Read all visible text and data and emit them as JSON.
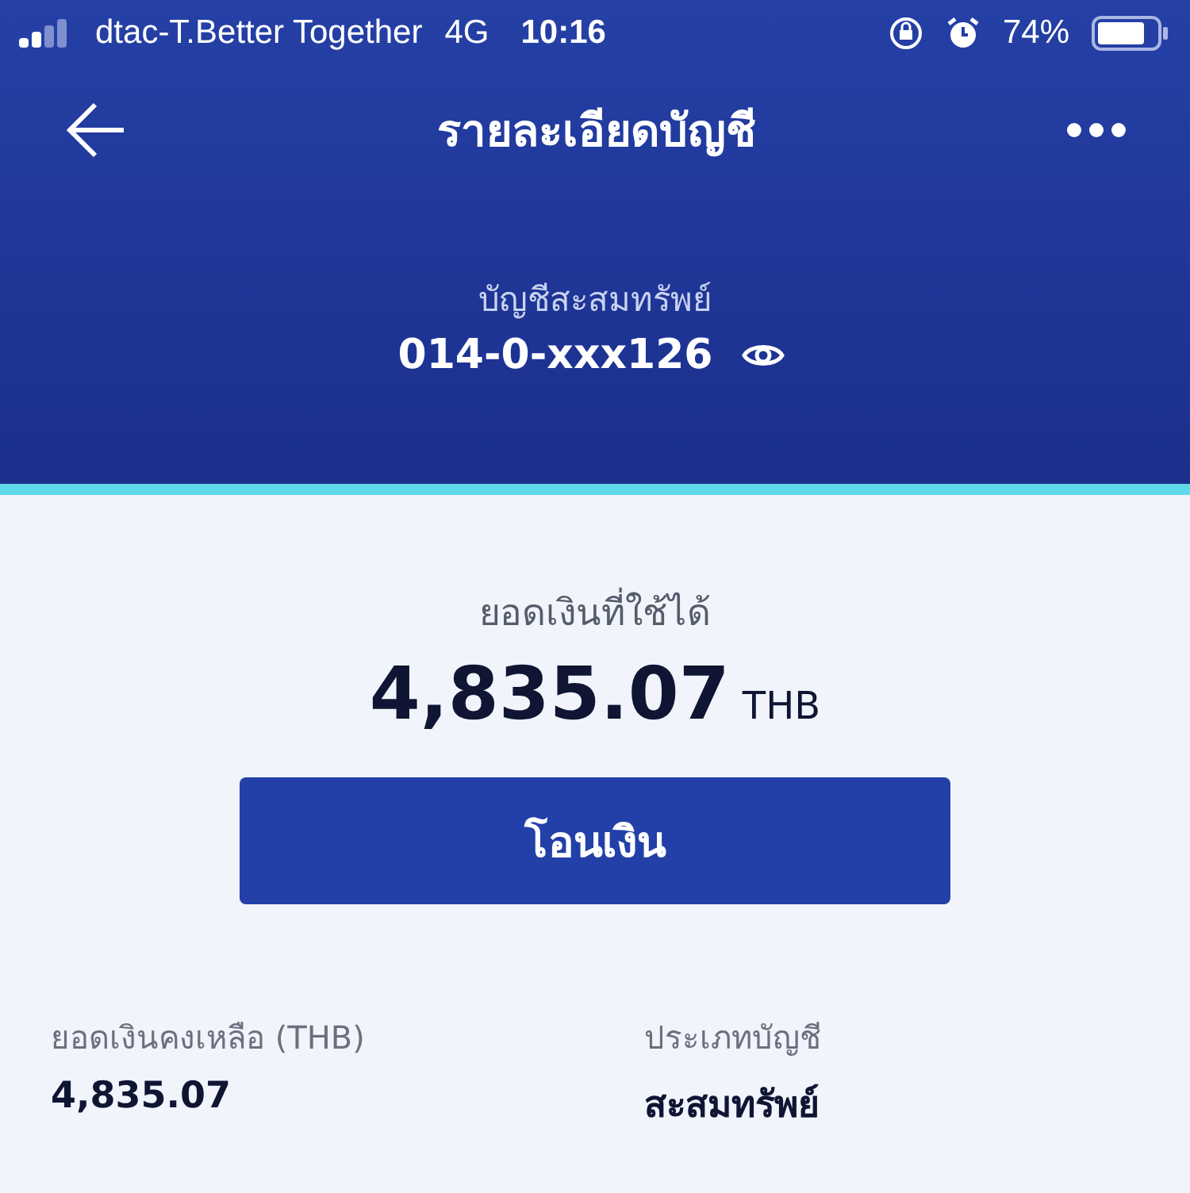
{
  "status_bar": {
    "carrier": "dtac-T.Better Together",
    "network": "4G",
    "time": "10:16",
    "battery": "74%"
  },
  "header": {
    "title": "รายละเอียดบัญชี",
    "account_type": "บัญชีสะสมทรัพย์",
    "account_number": "014-0-xxx126"
  },
  "balance": {
    "label": "ยอดเงินที่ใช้ได้",
    "amount": "4,835.07",
    "currency": "THB"
  },
  "action_button": "โอนเงิน",
  "details": [
    {
      "label": "ยอดเงินคงเหลือ (THB)",
      "value": "4,835.07"
    },
    {
      "label": "ประเภทบัญชี",
      "value": "สะสมทรัพย์"
    }
  ]
}
